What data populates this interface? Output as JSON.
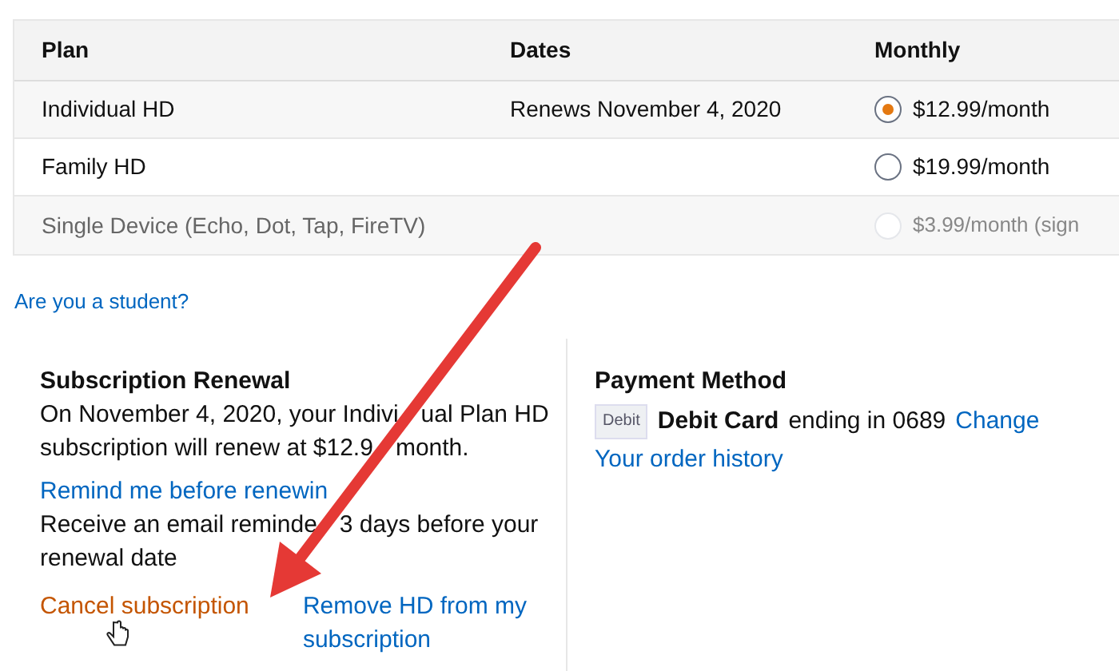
{
  "table": {
    "columns": [
      "Plan",
      "Dates",
      "Monthly"
    ],
    "rows": [
      {
        "plan": "Individual HD",
        "dates": "Renews November 4, 2020",
        "price": "$12.99/month",
        "selected": true,
        "disabled": false
      },
      {
        "plan": "Family HD",
        "price": "$19.99/month",
        "selected": false,
        "disabled": false
      },
      {
        "plan": "Single Device (Echo, Dot, Tap, FireTV)",
        "price": "$3.99/month (sign",
        "selected": false,
        "disabled": true
      }
    ]
  },
  "student_link": "Are you a student?",
  "renewal": {
    "title": "Subscription Renewal",
    "text_lines": [
      [
        "On November 4, 2020, your Indivi",
        "ual Plan HD"
      ],
      [
        "subscription will renew at $12.9",
        "month."
      ]
    ],
    "remind_link": "Remind me before renewin",
    "remind_lines": [
      [
        "Receive an email reminde",
        "3 days before your"
      ],
      [
        "renewal date"
      ]
    ],
    "cancel_link": "Cancel subscription",
    "remove_link": "Remove HD from my subscription"
  },
  "payment": {
    "title": "Payment Method",
    "card_badge": "Debit",
    "card_name": "Debit Card",
    "card_text": "ending in 0689",
    "change_link": "Change",
    "history_link": "Your order history"
  }
}
